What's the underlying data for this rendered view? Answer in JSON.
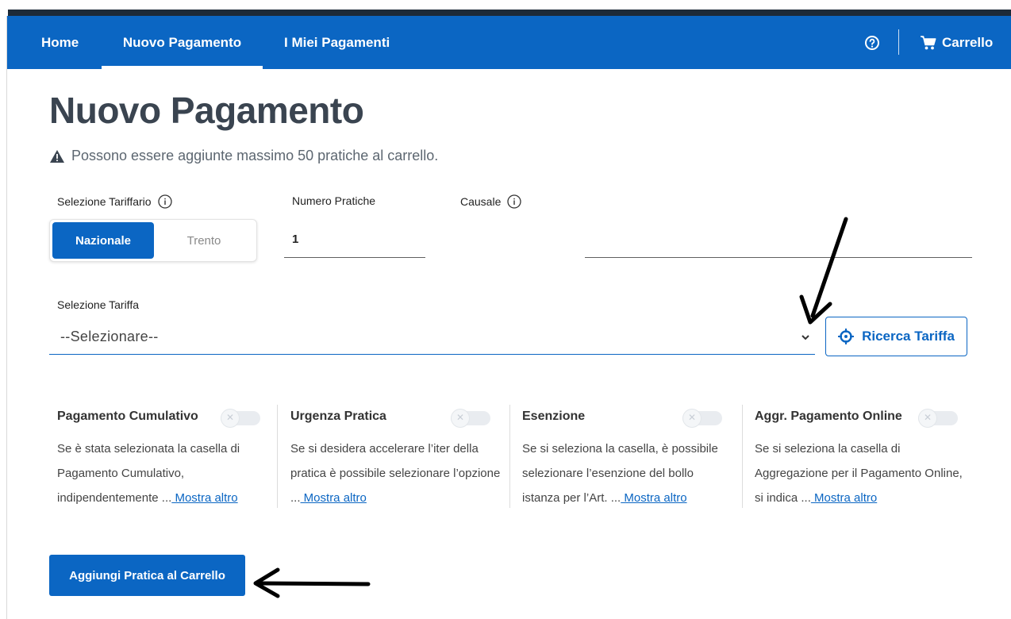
{
  "nav": {
    "items": [
      {
        "label": "Home"
      },
      {
        "label": "Nuovo Pagamento"
      },
      {
        "label": "I Miei Pagamenti"
      }
    ],
    "active_index": 1,
    "help_icon": "help-circle-icon",
    "cart_label": "Carrello",
    "cart_icon": "shopping-cart-icon"
  },
  "page": {
    "title": "Nuovo Pagamento",
    "warning": "Possono essere aggiunte massimo 50 pratiche al carrello.",
    "warning_icon": "warning-triangle-icon"
  },
  "form": {
    "tariffario_label": "Selezione Tariffario",
    "tariffario_options": [
      "Nazionale",
      "Trento"
    ],
    "tariffario_selected": "Nazionale",
    "numero_label": "Numero Pratiche",
    "numero_value": "1",
    "causale_label": "Causale",
    "causale_value": "",
    "tariffa_label": "Selezione Tariffa",
    "tariffa_value": "--Selezionare--",
    "ricerca_label": "Ricerca Tariffa",
    "ricerca_icon": "crosshair-icon"
  },
  "options": [
    {
      "title": "Pagamento Cumulativo",
      "desc": "Se è stata selezionata la casella di Pagamento Cumulativo, indipendentemente ...",
      "more": " Mostra altro",
      "enabled": false
    },
    {
      "title": "Urgenza Pratica",
      "desc": "Se si desidera accelerare l’iter della pratica è possibile selezionare l’opzione ...",
      "more": " Mostra altro",
      "enabled": false
    },
    {
      "title": "Esenzione",
      "desc": "Se si seleziona la casella, è possibile selezionare l’esenzione del bollo istanza per l’Art. ...",
      "more": " Mostra altro",
      "enabled": false
    },
    {
      "title": "Aggr. Pagamento Online",
      "desc": "Se si seleziona la casella di Aggregazione per il Pagamento Online, si indica ...",
      "more": " Mostra altro",
      "enabled": false
    }
  ],
  "toggle_symbol": "✕",
  "actions": {
    "add_label": "Aggiungi Pratica al Carrello"
  },
  "colors": {
    "primary": "#0b66c3",
    "title": "#3a4450"
  }
}
